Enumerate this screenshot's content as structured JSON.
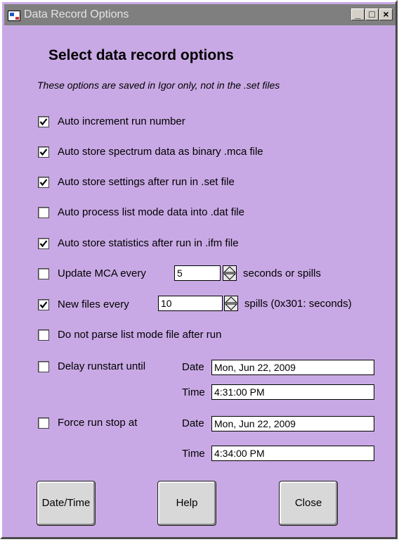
{
  "window": {
    "title": "Data Record Options",
    "title_buttons": [
      "_",
      "□",
      "×"
    ]
  },
  "heading": "Select data record options",
  "subheading": "These options are saved in Igor only, not in the .set files",
  "options": [
    {
      "label": "Auto increment run number",
      "checked": true
    },
    {
      "label": "Auto store spectrum data as binary .mca file",
      "checked": true
    },
    {
      "label": "Auto store settings after run in .set file",
      "checked": true
    },
    {
      "label": "Auto process list mode data into .dat file",
      "checked": false
    },
    {
      "label": "Auto store statistics after run in .ifm file",
      "checked": true
    },
    {
      "label": "Update MCA every",
      "checked": false
    },
    {
      "label": "New files every",
      "checked": true
    },
    {
      "label": "Do not parse list mode file after run",
      "checked": false
    },
    {
      "label": "Delay runstart until",
      "checked": false
    },
    {
      "label": "Force run stop at",
      "checked": false
    }
  ],
  "update_mca": {
    "value": "5",
    "suffix": "seconds or spills"
  },
  "new_files": {
    "value": "10",
    "suffix": "spills (0x301: seconds)"
  },
  "delay_runstart": {
    "date_label": "Date",
    "date": "Mon, Jun 22, 2009",
    "time_label": "Time",
    "time": "4:31:00 PM"
  },
  "force_stop": {
    "date_label": "Date",
    "date": "Mon, Jun 22, 2009",
    "time_label": "Time",
    "time": "4:34:00 PM"
  },
  "buttons": {
    "datetime": "Date/Time",
    "help": "Help",
    "close": "Close"
  }
}
